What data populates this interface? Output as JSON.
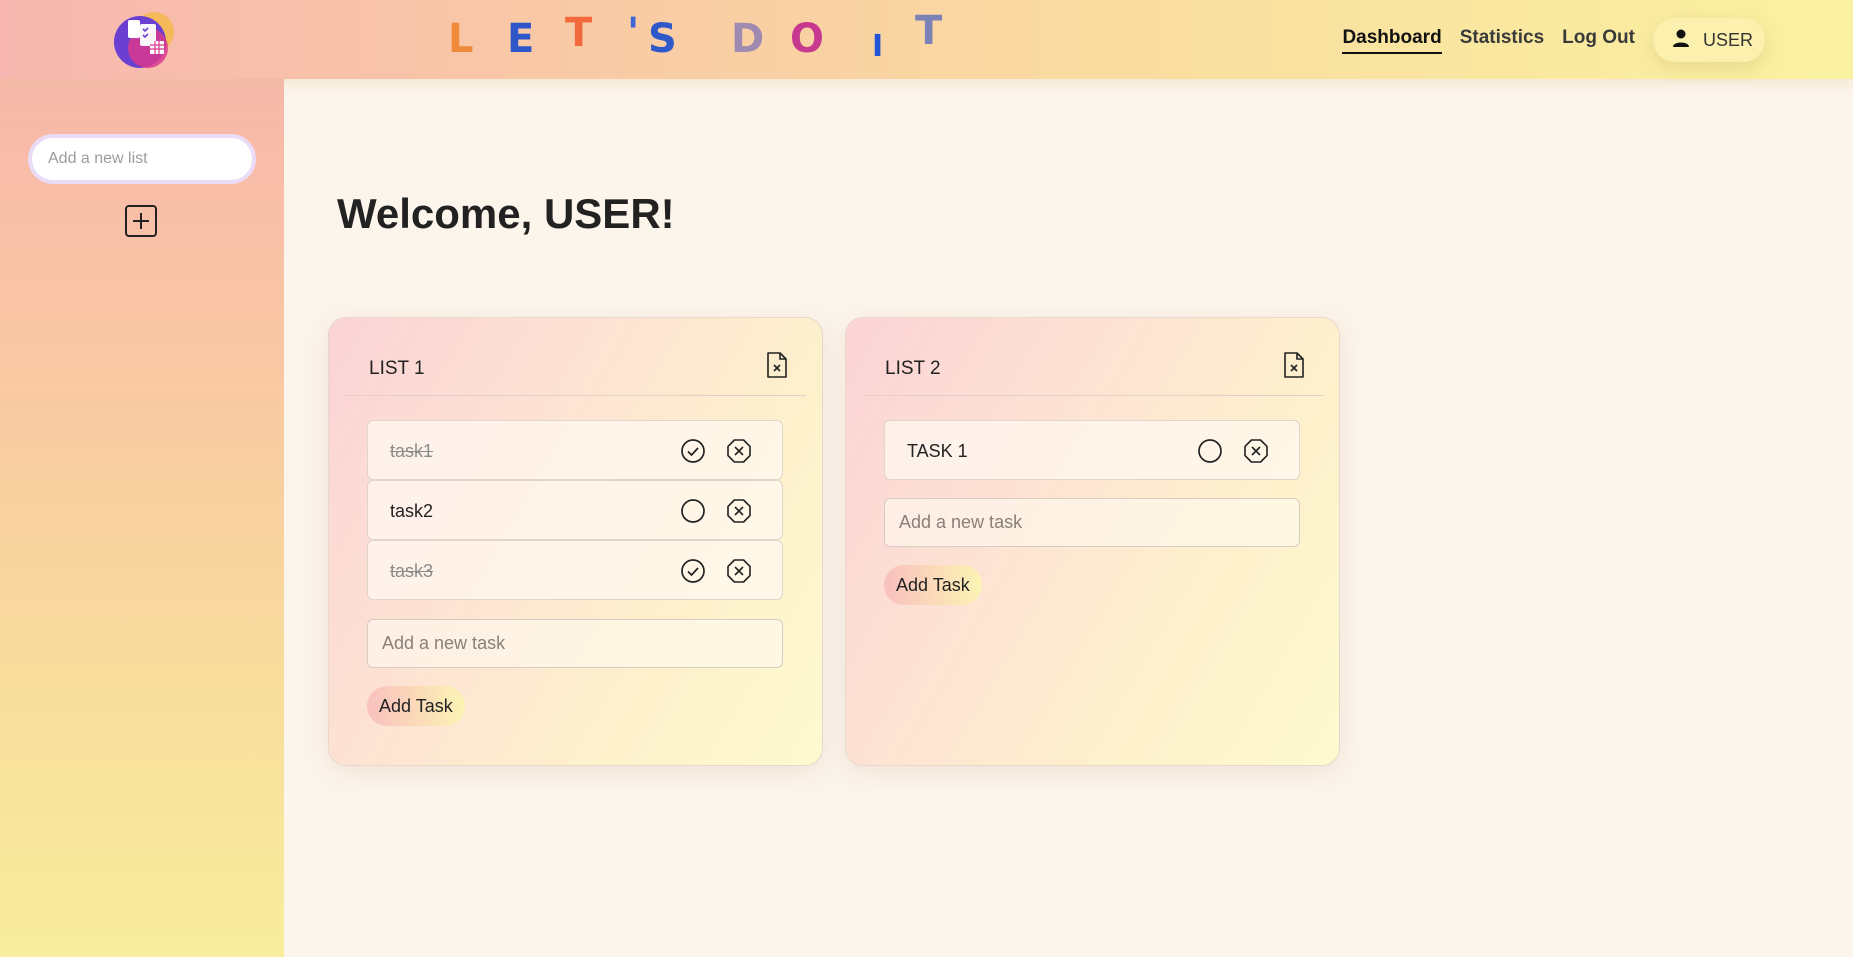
{
  "header": {
    "brand_letters": [
      {
        "char": "L",
        "color": "#f28a3c"
      },
      {
        "char": "E",
        "color": "#2e56c9"
      },
      {
        "char": "T",
        "color": "#f26a3c"
      },
      {
        "char": "'",
        "color": "#3b68d6"
      },
      {
        "char": "S",
        "color": "#2f58c8"
      },
      {
        "char": "D",
        "color": "#9f8ab2"
      },
      {
        "char": "O",
        "color": "#c7398e"
      },
      {
        "char": "I",
        "color": "#2255d6"
      },
      {
        "char": "T",
        "color": "#7b82b6"
      }
    ],
    "logo_icon": "todo-app-logo",
    "nav": {
      "dashboard": "Dashboard",
      "statistics": "Statistics",
      "logout": "Log Out"
    },
    "user": {
      "icon": "user-icon",
      "name": "USER"
    }
  },
  "sidebar": {
    "new_list_placeholder": "Add a new list",
    "add_list_icon": "plus-square-icon"
  },
  "main": {
    "welcome": "Welcome, USER!",
    "lists": [
      {
        "title": "LIST 1",
        "tasks": [
          {
            "text": "task1",
            "done": true
          },
          {
            "text": "task2",
            "done": false
          },
          {
            "text": "task3",
            "done": true
          }
        ],
        "new_task_placeholder": "Add a new task",
        "add_task_label": "Add Task"
      },
      {
        "title": "LIST 2",
        "tasks": [
          {
            "text": "TASK 1",
            "done": false
          }
        ],
        "new_task_placeholder": "Add a new task",
        "add_task_label": "Add Task"
      }
    ]
  },
  "colors": {
    "accent_text": "#222222",
    "active_nav_underline": "#111111"
  }
}
